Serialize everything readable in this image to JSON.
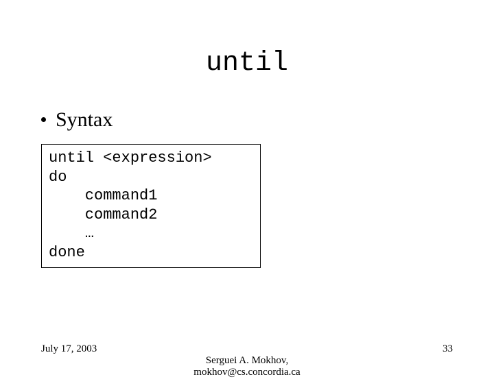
{
  "title": "until",
  "bullet": "Syntax",
  "code": {
    "l1": "until <expression>",
    "l2": "do",
    "l3": "    command1",
    "l4": "    command2",
    "l5": "    …",
    "l6": "done"
  },
  "footer": {
    "date": "July 17, 2003",
    "author": "Serguei A. Mokhov,",
    "email": "mokhov@cs.concordia.ca",
    "page": "33"
  }
}
